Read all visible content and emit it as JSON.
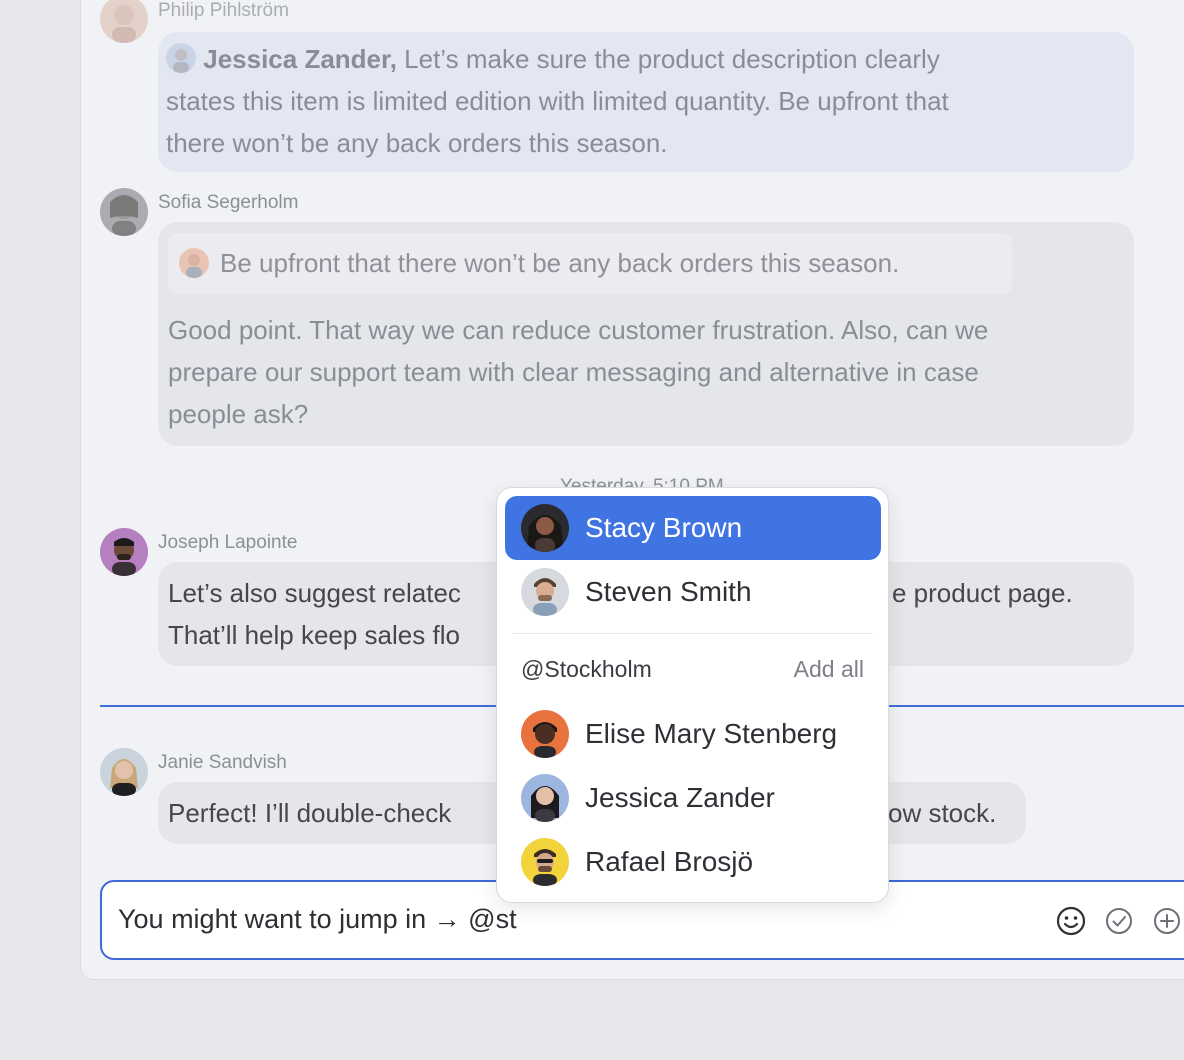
{
  "messages": [
    {
      "sender": "Philip Pihlström",
      "mention": "Jessica Zander,",
      "line1": "Let’s make sure the product description clearly",
      "line2": "states this item is limited edition with limited quantity. Be upfront that",
      "line3": "there won’t be any back orders this season."
    },
    {
      "sender": "Sofia Segerholm",
      "quote": "Be upfront that there won’t be any back orders this season.",
      "line1": "Good point. That way we can reduce customer frustration. Also, can we",
      "line2": "prepare our support team with clear messaging and alternative in case",
      "line3": "people ask?"
    },
    {
      "sender": "Joseph Lapointe",
      "line1a": "Let’s also suggest relatec",
      "line1b": "e product page.",
      "line2": "That’ll help keep sales flo"
    },
    {
      "sender": "Janie Sandvish",
      "line1a": "Perfect! I’ll double-check",
      "line1b": "ow stock."
    }
  ],
  "timestamp": "Yesterday, 5:10 PM",
  "composer": {
    "text": "You might want to jump in → @st",
    "icons": [
      "emoji-icon",
      "check-circle-icon",
      "plus-circle-icon"
    ]
  },
  "mention_popup": {
    "suggestions": [
      {
        "name": "Stacy Brown",
        "selected": true
      },
      {
        "name": "Steven Smith",
        "selected": false
      }
    ],
    "group": {
      "label": "@Stockholm",
      "action": "Add all",
      "members": [
        "Elise Mary Stenberg",
        "Jessica Zander",
        "Rafael Brosjö"
      ]
    }
  },
  "colors": {
    "accent": "#3f74e2",
    "highlight_bubble": "#e2e7f2",
    "bubble": "#e5e6ea"
  }
}
